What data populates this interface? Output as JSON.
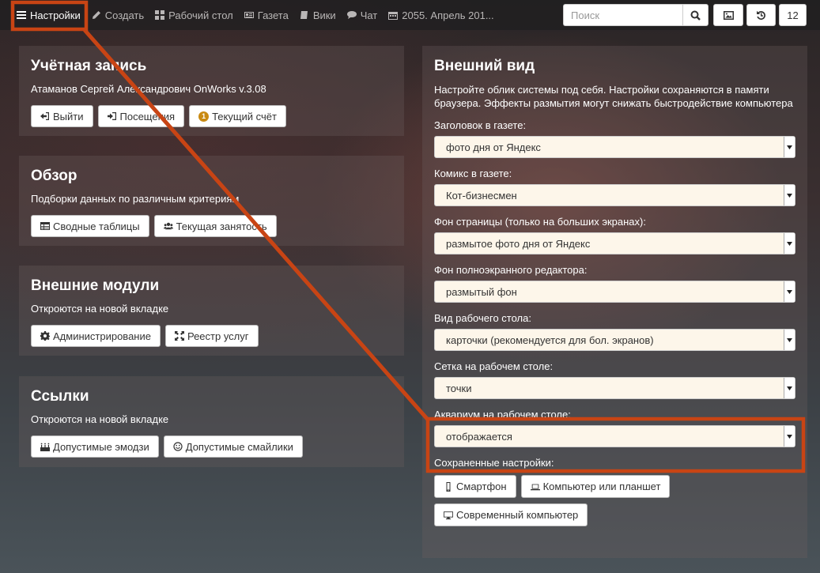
{
  "nav": {
    "items": [
      {
        "label": "Настройки",
        "icon": "menu-icon"
      },
      {
        "label": "Создать",
        "icon": "pencil-icon"
      },
      {
        "label": "Рабочий стол",
        "icon": "grid-icon"
      },
      {
        "label": "Газета",
        "icon": "newspaper-icon"
      },
      {
        "label": "Вики",
        "icon": "book-icon"
      },
      {
        "label": "Чат",
        "icon": "chat-icon"
      },
      {
        "label": "2055. Апрель 201...",
        "icon": "calendar-icon"
      }
    ],
    "search_placeholder": "Поиск",
    "counter": "12"
  },
  "account": {
    "title": "Учётная запись",
    "subtitle": "Атаманов Сергей Александрович OnWorks v.3.08",
    "buttons": [
      "Выйти",
      "Посещения",
      "Текущий счёт"
    ],
    "coin_badge": "1"
  },
  "overview": {
    "title": "Обзор",
    "subtitle": "Подборки данных по различным критериям",
    "buttons": [
      "Сводные таблицы",
      "Текущая занятость"
    ]
  },
  "modules": {
    "title": "Внешние модули",
    "subtitle": "Откроются на новой вкладке",
    "buttons": [
      "Администрирование",
      "Реестр услуг"
    ]
  },
  "links": {
    "title": "Ссылки",
    "subtitle": "Откроются на новой вкладке",
    "buttons": [
      "Допустимые эмодзи",
      "Допустимые смайлики"
    ]
  },
  "appearance": {
    "title": "Внешний вид",
    "description": "Настройте облик системы под себя. Настройки сохраняются в памяти браузера. Эффекты размытия могут снижать быстродействие компьютера",
    "fields": [
      {
        "label": "Заголовок в газете:",
        "value": "фото дня от Яндекс"
      },
      {
        "label": "Комикс в газете:",
        "value": "Кот-бизнесмен"
      },
      {
        "label": "Фон страницы (только на больших экранах):",
        "value": "размытое фото дня от Яндекс"
      },
      {
        "label": "Фон полноэкранного редактора:",
        "value": "размытый фон"
      },
      {
        "label": "Вид рабочего стола:",
        "value": "карточки (рекомендуется для бол. экранов)"
      },
      {
        "label": "Сетка на рабочем столе:",
        "value": "точки"
      },
      {
        "label": "Аквариум на рабочем столе:",
        "value": "отображается"
      }
    ],
    "saved_label": "Сохраненные настройки:",
    "saved_buttons": [
      "Смартфон",
      "Компьютер или планшет",
      "Современный компьютер"
    ]
  },
  "colors": {
    "annotation": "#c84414"
  }
}
